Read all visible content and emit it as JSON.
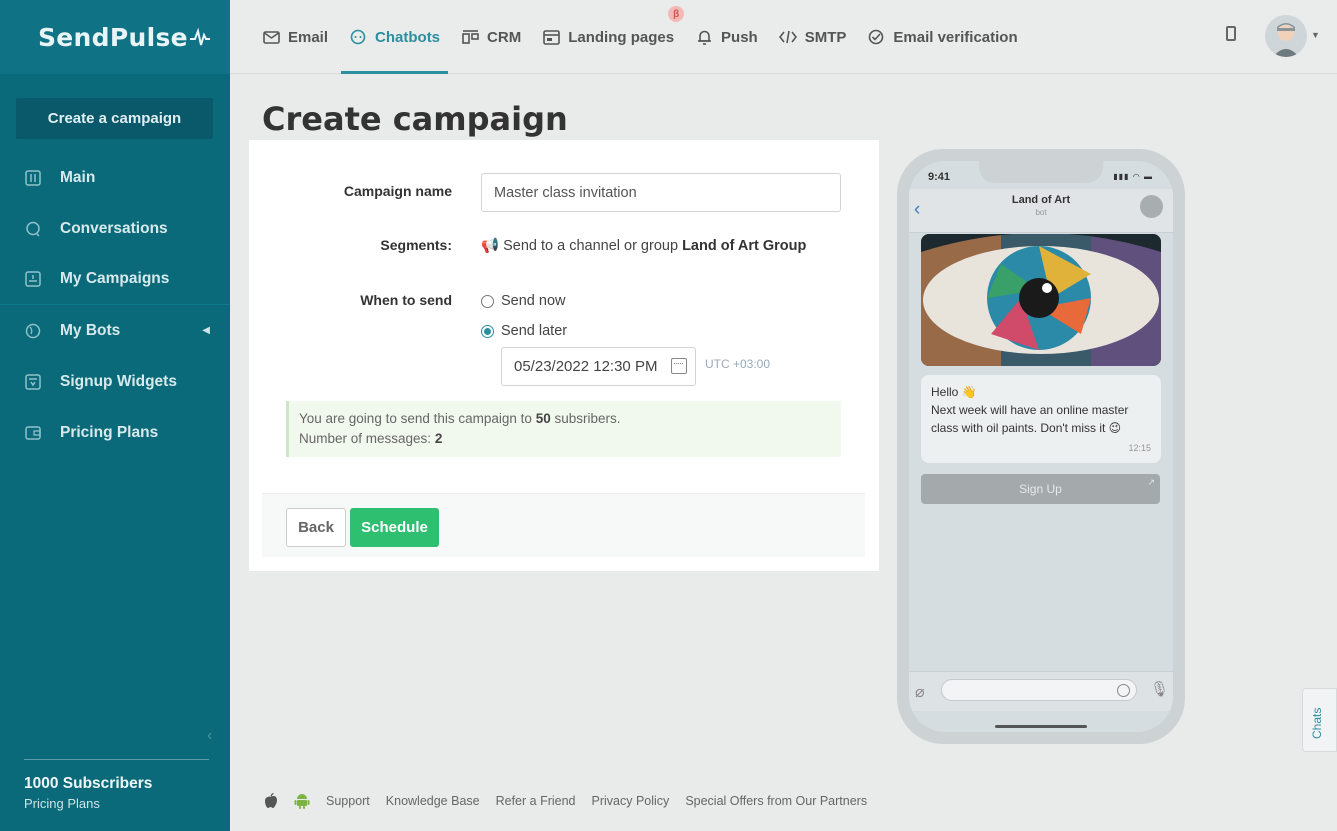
{
  "brand": {
    "name": "SendPulse"
  },
  "sidebar": {
    "create_label": "Create a campaign",
    "items": [
      {
        "label": "Main",
        "icon": "sliders-icon"
      },
      {
        "label": "Conversations",
        "icon": "chat-bubble-icon"
      },
      {
        "label": "My Campaigns",
        "icon": "campaign-icon"
      },
      {
        "label": "My Bots",
        "icon": "globe-icon"
      },
      {
        "label": "Signup Widgets",
        "icon": "widget-icon"
      },
      {
        "label": "Pricing Plans",
        "icon": "wallet-icon"
      }
    ],
    "subscribers": "1000 Subscribers",
    "plan_link": "Pricing Plans"
  },
  "topnav": {
    "tabs": [
      {
        "label": "Email",
        "icon": "envelope-icon"
      },
      {
        "label": "Chatbots",
        "icon": "chatbot-icon",
        "active": true
      },
      {
        "label": "CRM",
        "icon": "crm-icon"
      },
      {
        "label": "Landing pages",
        "icon": "landing-icon",
        "badge": "β"
      },
      {
        "label": "Push",
        "icon": "bell-icon"
      },
      {
        "label": "SMTP",
        "icon": "code-icon"
      },
      {
        "label": "Email verification",
        "icon": "check-circle-icon"
      }
    ]
  },
  "page": {
    "title": "Create campaign"
  },
  "form": {
    "name_label": "Campaign name",
    "name_value": "Master class invitation",
    "segments_label": "Segments:",
    "segments_prefix": "📢 Send to a channel or group",
    "segments_target": "Land of Art Group",
    "when_label": "When to send",
    "send_now": "Send now",
    "send_later": "Send later",
    "selected": "send_later",
    "date_value": "05/23/2022 12:30 PM",
    "timezone": "UTC +03:00",
    "notice_line1_prefix": "You are going to send this campaign to",
    "notice_count": "50",
    "notice_line1_suffix": "subsribers.",
    "notice_line2_prefix": "Number of messages:",
    "notice_messages": "2",
    "back_label": "Back",
    "schedule_label": "Schedule"
  },
  "phone": {
    "time": "9:41",
    "chat_name": "Land of Art",
    "chat_sub": "bot",
    "message_line1": "Hello 👋",
    "message_line2": "Next week will have an online master class with oil paints. Don't miss it 😉",
    "message_time": "12:15",
    "signup_button": "Sign Up"
  },
  "footer": {
    "links": [
      "Support",
      "Knowledge Base",
      "Refer a Friend",
      "Privacy Policy",
      "Special Offers from Our Partners"
    ]
  },
  "chats_tab": "Chats",
  "colors": {
    "sidebar": "#0b6a7a",
    "accent": "#2b8fa0",
    "schedule": "#2fbf71"
  }
}
